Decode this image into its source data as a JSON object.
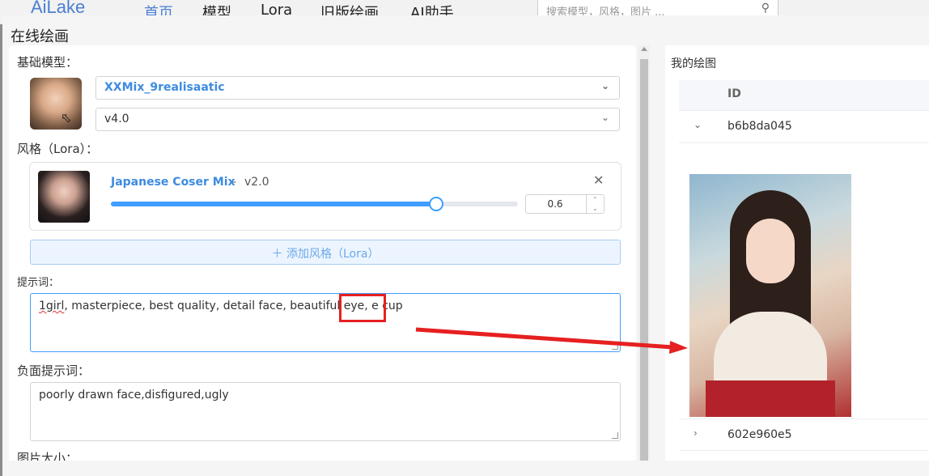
{
  "topnav": {
    "logo": "AiLake",
    "items": [
      "首页",
      "模型",
      "Lora",
      "旧版绘画",
      "AI助手"
    ],
    "search_placeholder": "搜索模型，风格，图片 ..."
  },
  "dialog": {
    "title": "在线绘画"
  },
  "form": {
    "base_model_label": "基础模型：",
    "model_name": "XXMix_9realisaatic",
    "model_version": "v4.0",
    "lora_label": "风格（Lora）：",
    "lora": {
      "name": "Japanese Coser Mix",
      "separator": "-",
      "version": "v2.0",
      "weight": "0.6",
      "slider_fraction": 0.8
    },
    "add_lora_label": "＋ 添加风格（Lora）",
    "prompt_label": "提示词：",
    "prompt_word_1": "1girl",
    "prompt_rest": ", masterpiece, best quality, detail face, beautiful eye, e cup",
    "negative_label": "负面提示词：",
    "negative_value": "poorly drawn face,disfigured,ugly",
    "size_label": "图片大小："
  },
  "results": {
    "title": "我的绘图",
    "column_id": "ID",
    "rows": [
      {
        "id": "b6b8da045",
        "expanded": true
      },
      {
        "id": "602e960e5",
        "expanded": false
      }
    ]
  },
  "icons": {
    "dropdown": "chevron-down-icon",
    "close": "close-icon",
    "expand": "chevron-right-icon",
    "search": "search-icon"
  },
  "colors": {
    "accent": "#409eff",
    "link": "#3d8be0",
    "annotation": "#e62020"
  }
}
